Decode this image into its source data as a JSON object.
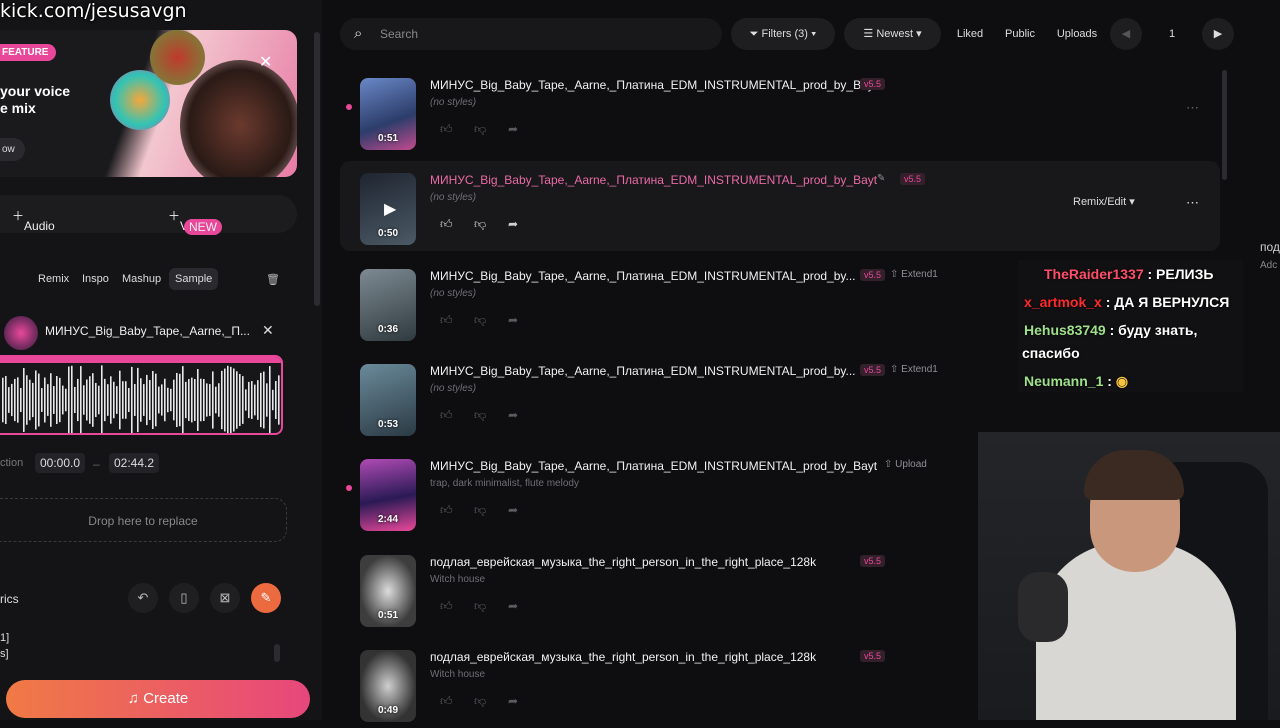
{
  "overlay": {
    "stream_url": "kick.com/jesusavgn"
  },
  "banner": {
    "feature_label": "FEATURE",
    "headline_line1": "your voice",
    "headline_line2": "e mix",
    "cta": "ow"
  },
  "add_row": {
    "audio": "Audio",
    "voice": "Voice",
    "voice_badge": "NEW"
  },
  "modes": {
    "remix": "Remix",
    "inspo": "Inspo",
    "mashup": "Mashup",
    "sample": "Sample"
  },
  "source": {
    "title": "МИНУС_Big_Baby_Tape,_Aarne,_П..."
  },
  "section": {
    "label": "ction",
    "start": "00:00.0",
    "dash": "–",
    "end": "02:44.2"
  },
  "drop": {
    "text": "Drop here to replace"
  },
  "lyrics": {
    "label": "rics",
    "line1": "1]",
    "line2": "s]"
  },
  "create": {
    "label": "Create"
  },
  "toolbar": {
    "search_placeholder": "Search",
    "filters": "Filters (3)",
    "sort": "Newest",
    "liked": "Liked",
    "public": "Public",
    "uploads": "Uploads",
    "page": "1"
  },
  "rows": [
    {
      "title": "МИНУС_Big_Baby_Tape,_Aarne,_Платина_EDM_INSTRUMENTAL_prod_by_Bayt",
      "sub": "(no styles)",
      "dur": "0:51",
      "vtag": "v5.5",
      "extra": ""
    },
    {
      "title": "МИНУС_Big_Baby_Tape,_Aarne,_Платина_EDM_INSTRUMENTAL_prod_by_Bayt",
      "sub": "(no styles)",
      "dur": "0:50",
      "vtag": "v5.5",
      "extra": "",
      "remix": "Remix/Edit"
    },
    {
      "title": "МИНУС_Big_Baby_Tape,_Aarne,_Платина_EDM_INSTRUMENTAL_prod_by...",
      "sub": "(no styles)",
      "dur": "0:36",
      "vtag": "v5.5",
      "extra": "Extend1"
    },
    {
      "title": "МИНУС_Big_Baby_Tape,_Aarne,_Платина_EDM_INSTRUMENTAL_prod_by...",
      "sub": "(no styles)",
      "dur": "0:53",
      "vtag": "v5.5",
      "extra": "Extend1"
    },
    {
      "title": "МИНУС_Big_Baby_Tape,_Aarne,_Платина_EDM_INSTRUMENTAL_prod_by_Bayt",
      "sub": "trap, dark minimalist, flute melody",
      "dur": "2:44",
      "vtag": "",
      "extra": "Upload"
    },
    {
      "title": "подлая_еврейская_музыка_the_right_person_in_the_right_place_128k",
      "sub": "Witch house",
      "dur": "0:51",
      "vtag": "v5.5",
      "extra": ""
    },
    {
      "title": "подлая_еврейская_музыка_the_right_person_in_the_right_place_128k",
      "sub": "Witch house",
      "dur": "0:49",
      "vtag": "v5.5",
      "extra": ""
    }
  ],
  "chat": [
    {
      "user": "TheRaider1337",
      "msg": ": РЕЛИЗЬ",
      "color": "#ff4d6a"
    },
    {
      "user": "x_artmok_x",
      "msg": ": ДА Я ВЕРНУЛСЯ",
      "color": "#ff2a2a"
    },
    {
      "user": "Hehus83749",
      "msg": ": буду знать,",
      "color": "#9fe08a"
    },
    {
      "user": "",
      "msg": "спасибо",
      "color": "#ffffff"
    },
    {
      "user": "Neumann_1",
      "msg": ":",
      "color": "#9fe08a"
    }
  ],
  "right_edge": {
    "text1": "под",
    "text2": "Adc"
  }
}
